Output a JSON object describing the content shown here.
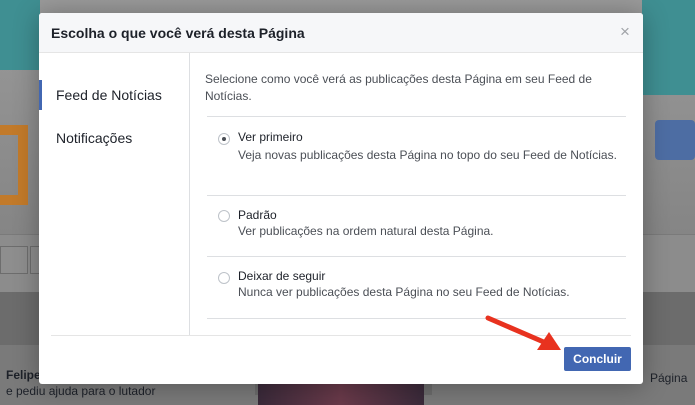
{
  "background": {
    "person_name": "Felipe",
    "post_snippet": "e pediu ajuda para o lutador",
    "right_label": "Página"
  },
  "dialog": {
    "title": "Escolha o que você verá desta Página",
    "close_glyph": "×",
    "sidebar": [
      {
        "label": "Feed de Notícias",
        "active": true
      },
      {
        "label": "Notificações",
        "active": false
      }
    ],
    "description": "Selecione como você verá as publicações desta Página em seu Feed de Notícias.",
    "options": [
      {
        "title": "Ver primeiro",
        "description": "Veja novas publicações desta Página no topo do seu Feed de Notícias.",
        "selected": true
      },
      {
        "title": "Padrão",
        "description": "Ver publicações na ordem natural desta Página.",
        "selected": false
      },
      {
        "title": "Deixar de seguir",
        "description": "Nunca ver publicações desta Página no seu Feed de Notícias.",
        "selected": false
      }
    ],
    "done_label": "Concluir"
  },
  "colors": {
    "primary_button": "#4267b2",
    "annotation_arrow": "#e8321f"
  }
}
